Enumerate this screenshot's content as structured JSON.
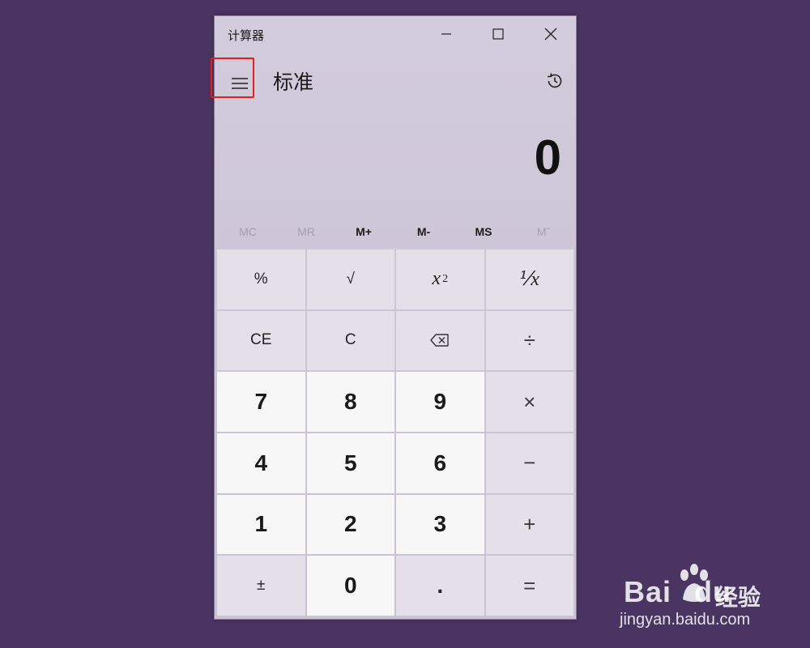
{
  "window": {
    "title": "计算器",
    "mode_title": "标准"
  },
  "display": {
    "value": "0"
  },
  "memory": [
    {
      "label": "MC",
      "enabled": false
    },
    {
      "label": "MR",
      "enabled": false
    },
    {
      "label": "M+",
      "enabled": true
    },
    {
      "label": "M-",
      "enabled": true
    },
    {
      "label": "MS",
      "enabled": true
    },
    {
      "label": "Mˇ",
      "enabled": false
    }
  ],
  "keys": {
    "percent": "%",
    "sqrt": "√",
    "square_base": "x",
    "square_exp": "2",
    "reciprocal": "⅟x",
    "ce": "CE",
    "c": "C",
    "divide": "÷",
    "n7": "7",
    "n8": "8",
    "n9": "9",
    "multiply": "×",
    "n4": "4",
    "n5": "5",
    "n6": "6",
    "minus": "−",
    "n1": "1",
    "n2": "2",
    "n3": "3",
    "plus": "+",
    "negate": "±",
    "n0": "0",
    "decimal": ".",
    "equals": "="
  },
  "icons": {
    "menu": "hamburger-menu-icon",
    "history": "history-icon",
    "backspace": "backspace-icon",
    "minimize": "minimize-icon",
    "maximize": "maximize-icon",
    "close": "close-icon"
  },
  "colors": {
    "page_background": "#4a3462",
    "highlight": "#e02020",
    "number_key": "#f7f7f8",
    "function_key": "#e7e3ec"
  },
  "watermark": {
    "logo": "Bai",
    "logo2": "du",
    "brand_cn": "经验",
    "url": "jingyan.baidu.com"
  }
}
